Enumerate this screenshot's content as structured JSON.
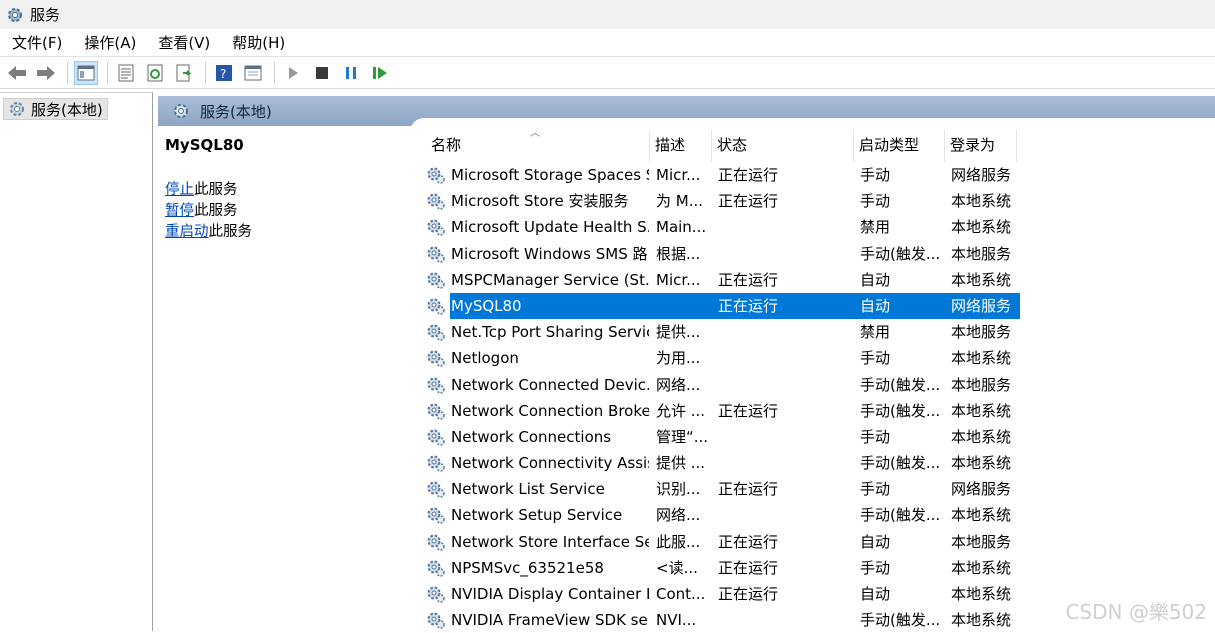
{
  "window": {
    "title": "服务"
  },
  "menu": [
    "文件(F)",
    "操作(A)",
    "查看(V)",
    "帮助(H)"
  ],
  "tree": {
    "root_label": "服务(本地)"
  },
  "panel": {
    "header": "服务(本地)"
  },
  "details": {
    "service_name": "MySQL80",
    "actions": [
      {
        "link": "停止",
        "rest": "此服务"
      },
      {
        "link": "暂停",
        "rest": "此服务"
      },
      {
        "link": "重启动",
        "rest": "此服务"
      }
    ]
  },
  "table": {
    "columns": [
      "名称",
      "描述",
      "状态",
      "启动类型",
      "登录为"
    ],
    "rows": [
      {
        "name": "Microsoft Storage Spaces S...",
        "desc": "Micr...",
        "status": "正在运行",
        "startup": "手动",
        "logon": "网络服务"
      },
      {
        "name": "Microsoft Store 安装服务",
        "desc": "为 M...",
        "status": "正在运行",
        "startup": "手动",
        "logon": "本地系统"
      },
      {
        "name": "Microsoft Update Health S...",
        "desc": "Main...",
        "status": "",
        "startup": "禁用",
        "logon": "本地系统"
      },
      {
        "name": "Microsoft Windows SMS 路...",
        "desc": "根据...",
        "status": "",
        "startup": "手动(触发...",
        "logon": "本地服务"
      },
      {
        "name": "MSPCManager Service (St...",
        "desc": "Micr...",
        "status": "正在运行",
        "startup": "自动",
        "logon": "本地系统"
      },
      {
        "name": "MySQL80",
        "desc": "",
        "status": "正在运行",
        "startup": "自动",
        "logon": "网络服务",
        "selected": true
      },
      {
        "name": "Net.Tcp Port Sharing Service",
        "desc": "提供...",
        "status": "",
        "startup": "禁用",
        "logon": "本地服务"
      },
      {
        "name": "Netlogon",
        "desc": "为用...",
        "status": "",
        "startup": "手动",
        "logon": "本地系统"
      },
      {
        "name": "Network Connected Devic...",
        "desc": "网络...",
        "status": "",
        "startup": "手动(触发...",
        "logon": "本地服务"
      },
      {
        "name": "Network Connection Broker",
        "desc": "允许 ...",
        "status": "正在运行",
        "startup": "手动(触发...",
        "logon": "本地系统"
      },
      {
        "name": "Network Connections",
        "desc": "管理“...",
        "status": "",
        "startup": "手动",
        "logon": "本地系统"
      },
      {
        "name": "Network Connectivity Assis...",
        "desc": "提供 ...",
        "status": "",
        "startup": "手动(触发...",
        "logon": "本地系统"
      },
      {
        "name": "Network List Service",
        "desc": "识别...",
        "status": "正在运行",
        "startup": "手动",
        "logon": "网络服务"
      },
      {
        "name": "Network Setup Service",
        "desc": "网络...",
        "status": "",
        "startup": "手动(触发...",
        "logon": "本地系统"
      },
      {
        "name": "Network Store Interface Se...",
        "desc": "此服...",
        "status": "正在运行",
        "startup": "自动",
        "logon": "本地服务"
      },
      {
        "name": "NPSMSvc_63521e58",
        "desc": "<读...",
        "status": "正在运行",
        "startup": "手动",
        "logon": "本地系统"
      },
      {
        "name": "NVIDIA Display Container LS",
        "desc": "Cont...",
        "status": "正在运行",
        "startup": "自动",
        "logon": "本地系统"
      },
      {
        "name": "NVIDIA FrameView SDK se...",
        "desc": "NVI...",
        "status": "",
        "startup": "手动(触发...",
        "logon": "本地系统"
      }
    ]
  },
  "watermark": "CSDN @樂502",
  "colors": {
    "selection": "#0078d7",
    "header_band": "#9bb2cf",
    "link": "#0046b8"
  }
}
